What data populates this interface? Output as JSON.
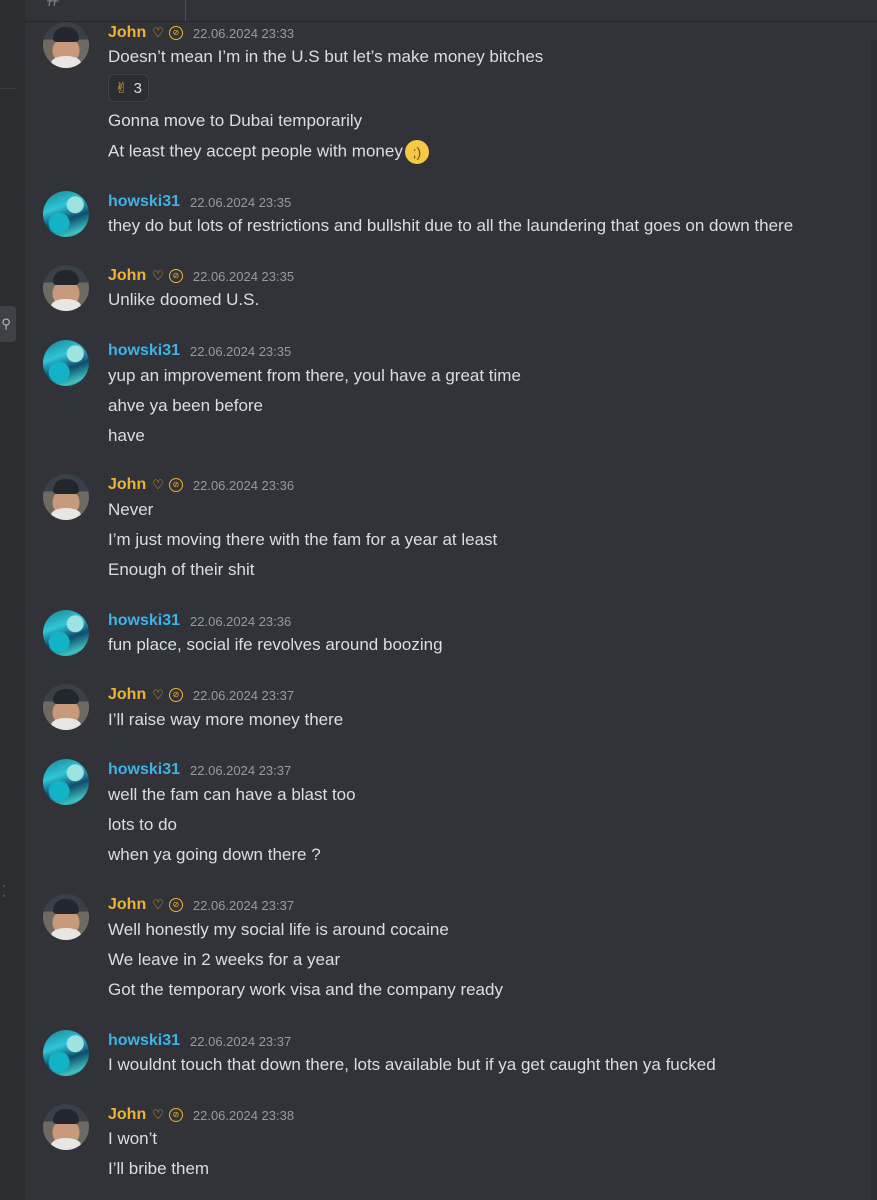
{
  "users": {
    "john": "John",
    "howski": "howski31"
  },
  "messages": [
    {
      "user": "John",
      "time": "22.06.2024 23:33",
      "lines": [
        "Doesn’t mean I’m in the U.S but let’s make money bitches"
      ],
      "reaction": {
        "emoji": "crossed-fingers-icon",
        "count": "3"
      },
      "extra_lines": [
        "Gonna move to Dubai temporarily",
        "At least they accept people with money"
      ]
    },
    {
      "user": "howski31",
      "time": "22.06.2024 23:35",
      "lines": [
        "they do but lots of restrictions and bullshit due to all the laundering that goes on down there"
      ]
    },
    {
      "user": "John",
      "time": "22.06.2024 23:35",
      "lines": [
        "Unlike doomed U.S."
      ]
    },
    {
      "user": "howski31",
      "time": "22.06.2024 23:35",
      "lines": [
        "yup an improvement from there, youl have a great time",
        "ahve ya been before",
        "have"
      ]
    },
    {
      "user": "John",
      "time": "22.06.2024 23:36",
      "lines": [
        "Never",
        "I’m just moving there with the fam for a year at least",
        "Enough of their shit"
      ]
    },
    {
      "user": "howski31",
      "time": "22.06.2024 23:36",
      "lines": [
        "fun place, social ife revolves around boozing"
      ]
    },
    {
      "user": "John",
      "time": "22.06.2024 23:37",
      "lines": [
        "I’ll raise way more money there"
      ]
    },
    {
      "user": "howski31",
      "time": "22.06.2024 23:37",
      "lines": [
        "well the fam can have a blast too",
        "lots to do",
        "when ya going down there ?"
      ]
    },
    {
      "user": "John",
      "time": "22.06.2024 23:37",
      "lines": [
        "Well honestly my social life is around cocaine",
        "We leave in 2 weeks for a year",
        "Got the temporary work visa and the company ready"
      ]
    },
    {
      "user": "howski31",
      "time": "22.06.2024 23:37",
      "lines": [
        "I wouldnt touch that down there, lots available but if ya get caught then ya fucked"
      ]
    },
    {
      "user": "John",
      "time": "22.06.2024 23:38",
      "lines": [
        "I won’t",
        "I’ll bribe them"
      ]
    }
  ],
  "colors": {
    "background": "#313338",
    "john": "#f0b232",
    "howski": "#3fb3e8",
    "timestamp": "#949ba4",
    "text": "#dbdee1"
  }
}
